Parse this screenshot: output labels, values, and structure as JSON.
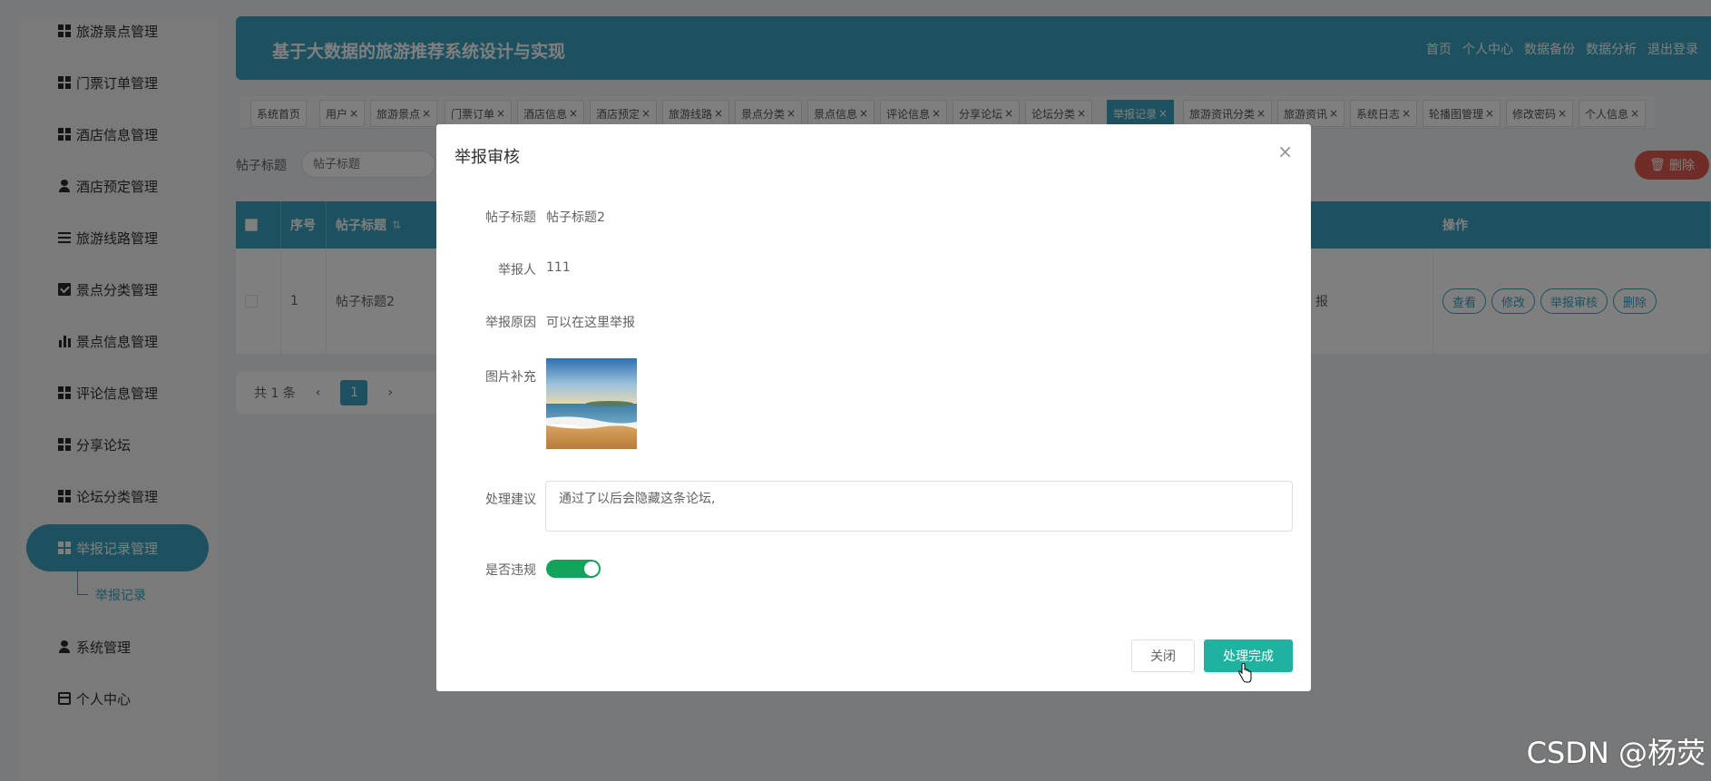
{
  "sidebar": {
    "items": [
      {
        "label": "旅游景点管理",
        "icon": "grid-icon"
      },
      {
        "label": "门票订单管理",
        "icon": "grid-icon"
      },
      {
        "label": "酒店信息管理",
        "icon": "grid-icon"
      },
      {
        "label": "酒店预定管理",
        "icon": "user-icon"
      },
      {
        "label": "旅游线路管理",
        "icon": "list-icon"
      },
      {
        "label": "景点分类管理",
        "icon": "checkbox-icon"
      },
      {
        "label": "景点信息管理",
        "icon": "bar-chart-icon"
      },
      {
        "label": "评论信息管理",
        "icon": "grid-icon"
      },
      {
        "label": "分享论坛",
        "icon": "grid-icon"
      },
      {
        "label": "论坛分类管理",
        "icon": "grid-icon"
      },
      {
        "label": "举报记录管理",
        "icon": "grid-icon",
        "active": true
      },
      {
        "label": "系统管理",
        "icon": "user-icon"
      },
      {
        "label": "个人中心",
        "icon": "card-icon"
      }
    ],
    "submenu_label": "举报记录"
  },
  "header": {
    "title": "基于大数据的旅游推荐系统设计与实现",
    "links": [
      "首页",
      "个人中心",
      "数据备份",
      "数据分析",
      "退出登录"
    ]
  },
  "tabs": [
    {
      "label": "系统首页",
      "closable": false
    },
    {
      "label": "用户",
      "closable": true
    },
    {
      "label": "旅游景点",
      "closable": true
    },
    {
      "label": "门票订单",
      "closable": true
    },
    {
      "label": "酒店信息",
      "closable": true
    },
    {
      "label": "酒店预定",
      "closable": true
    },
    {
      "label": "旅游线路",
      "closable": true
    },
    {
      "label": "景点分类",
      "closable": true
    },
    {
      "label": "景点信息",
      "closable": true
    },
    {
      "label": "评论信息",
      "closable": true
    },
    {
      "label": "分享论坛",
      "closable": true
    },
    {
      "label": "论坛分类",
      "closable": true
    },
    {
      "label": "举报记录",
      "closable": true,
      "active": true
    },
    {
      "label": "旅游资讯分类",
      "closable": true
    },
    {
      "label": "旅游资讯",
      "closable": true
    },
    {
      "label": "系统日志",
      "closable": true
    },
    {
      "label": "轮播图管理",
      "closable": true
    },
    {
      "label": "修改密码",
      "closable": true
    },
    {
      "label": "个人信息",
      "closable": true
    }
  ],
  "search": {
    "label": "帖子标题",
    "placeholder": "帖子标题"
  },
  "delete_button": "删除",
  "table": {
    "headers": {
      "index": "序号",
      "title": "帖子标题",
      "sort_icon": "⇅",
      "ops": "操作"
    },
    "row": {
      "index": "1",
      "title": "帖子标题2",
      "status_fragment": "报"
    },
    "ops": [
      "查看",
      "修改",
      "举报审核",
      "删除"
    ]
  },
  "pagination": {
    "total": "共 1 条",
    "prev": "‹",
    "page": "1",
    "next": "›"
  },
  "dialog": {
    "title": "举报审核",
    "close_glyph": "×",
    "fields": {
      "post_title_label": "帖子标题",
      "post_title_value": "帖子标题2",
      "reporter_label": "举报人",
      "reporter_value": "111",
      "reason_label": "举报原因",
      "reason_value": "可以在这里举报",
      "image_label": "图片补充",
      "suggestion_label": "处理建议",
      "suggestion_value": "通过了以后会隐藏这条论坛,",
      "violation_label": "是否违规",
      "violation_on": true
    },
    "buttons": {
      "close": "关闭",
      "done": "处理完成"
    }
  },
  "watermark": "CSDN @杨荧",
  "colors": {
    "accent": "#3aa3bf",
    "done": "#20b2a0",
    "switch_on": "#13a35b",
    "danger": "#e05a4f"
  }
}
